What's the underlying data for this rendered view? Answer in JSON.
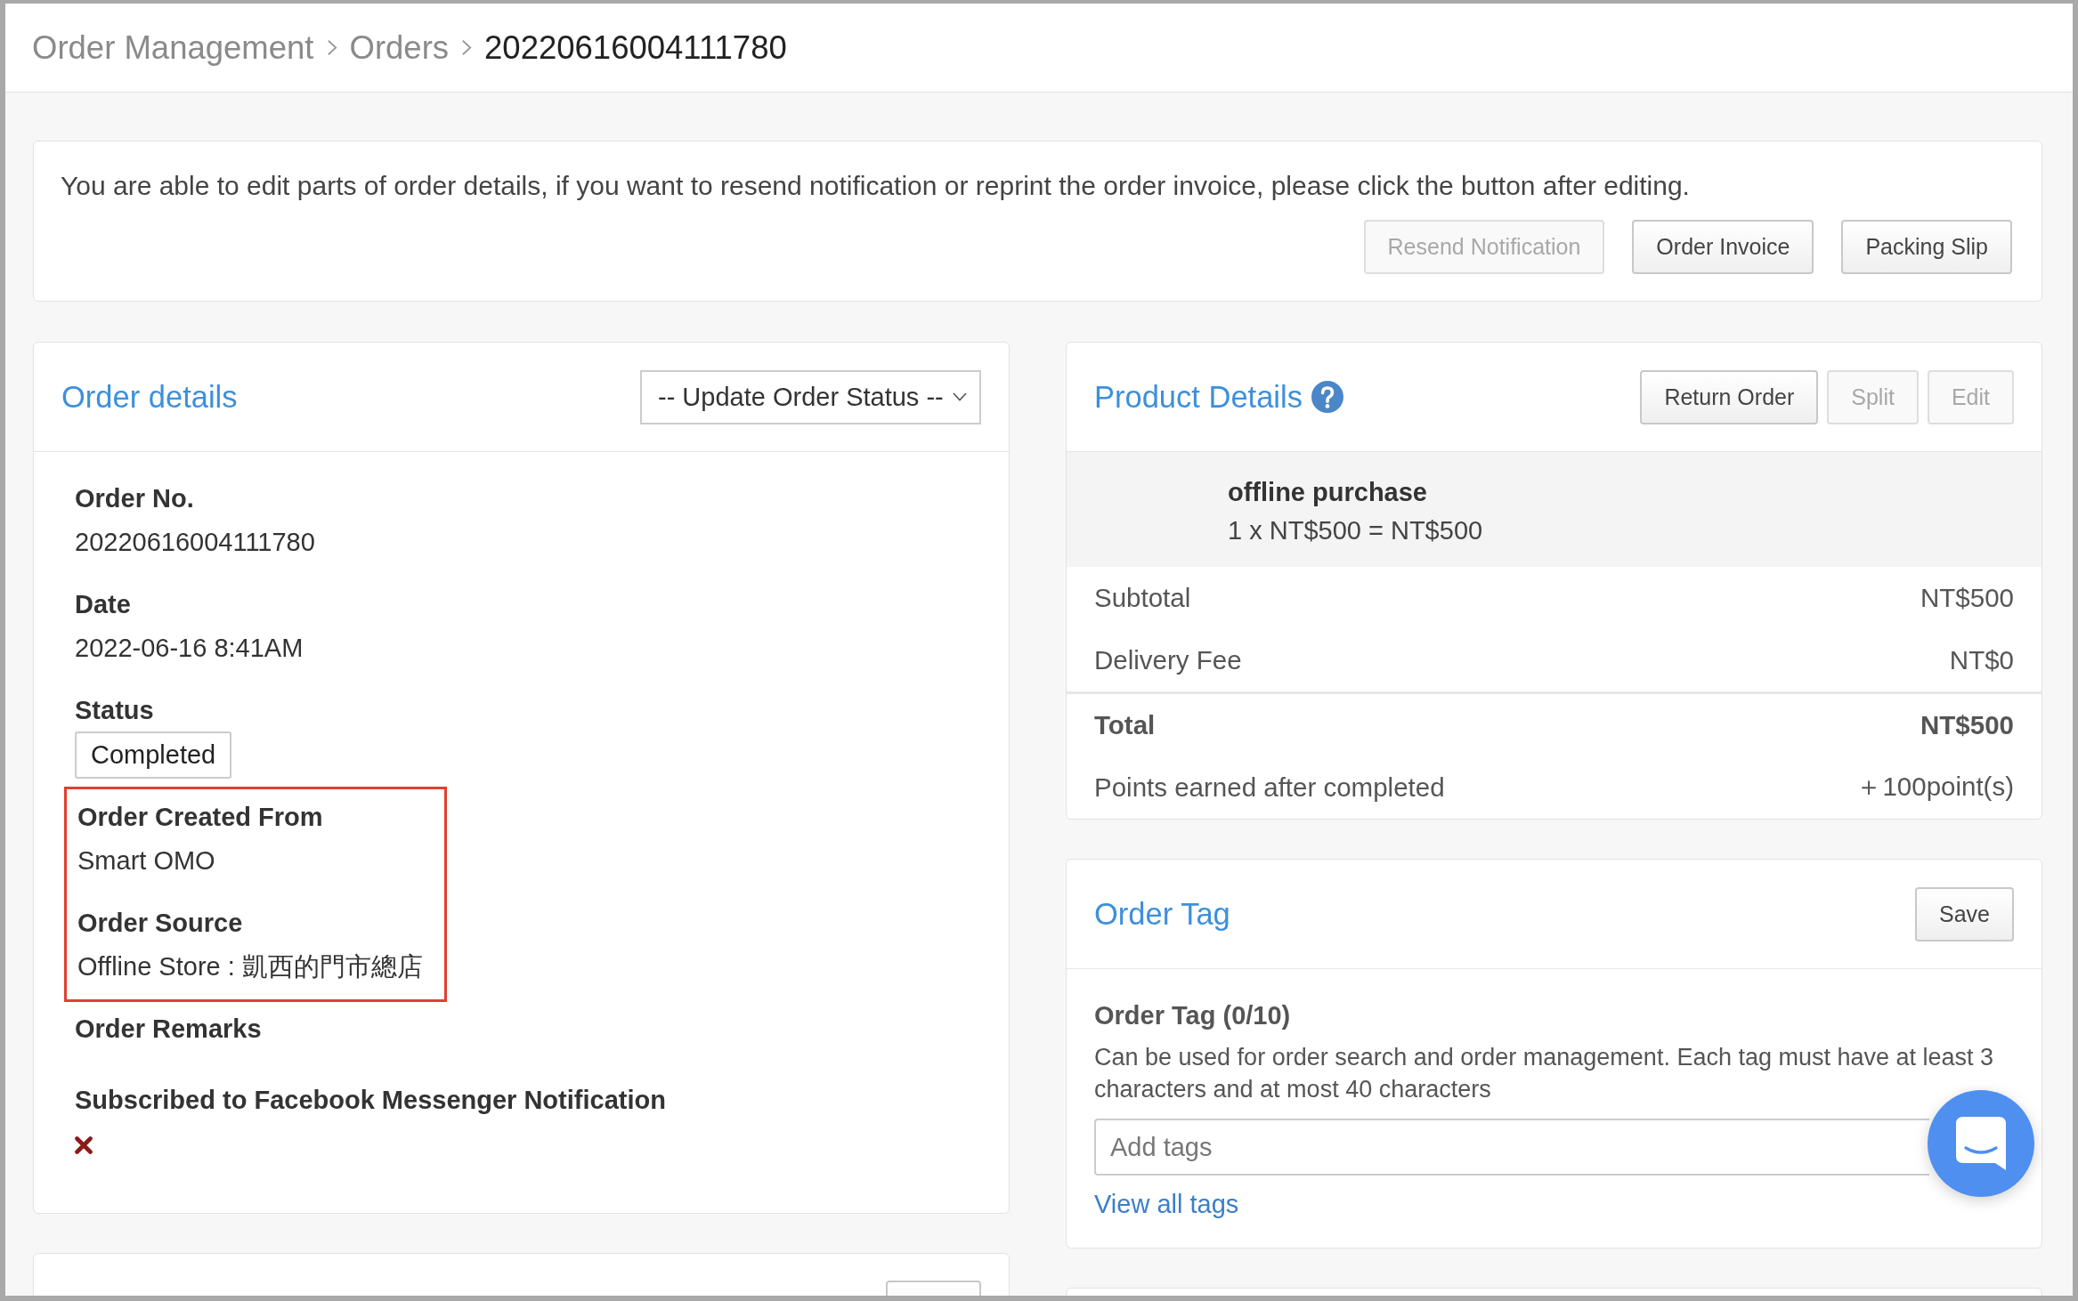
{
  "breadcrumb": [
    {
      "label": "Order Management",
      "current": false
    },
    {
      "label": "Orders",
      "current": false
    },
    {
      "label": "20220616004111780",
      "current": true
    }
  ],
  "notice": {
    "text": "You are able to edit parts of order details, if you want to resend notification or reprint the order invoice, please click the button after editing.",
    "buttons": [
      {
        "label": "Resend Notification",
        "disabled": true
      },
      {
        "label": "Order Invoice",
        "disabled": false
      },
      {
        "label": "Packing Slip",
        "disabled": false
      }
    ]
  },
  "order_details": {
    "title": "Order details",
    "status_select": {
      "value": "-- Update Order Status --"
    },
    "sections": [
      {
        "highlighted": false,
        "fields": [
          {
            "kind": "text",
            "label": "Order No.",
            "value": "20220616004111780"
          },
          {
            "kind": "text",
            "label": "Date",
            "value": "2022-06-16 8:41AM"
          },
          {
            "kind": "badge",
            "label": "Status",
            "value": "Completed"
          }
        ]
      },
      {
        "highlighted": true,
        "fields": [
          {
            "kind": "text",
            "label": "Order Created From",
            "value": "Smart OMO"
          },
          {
            "kind": "text",
            "label": "Order Source",
            "value": "Offline Store : 凱西的門市總店"
          }
        ]
      },
      {
        "highlighted": false,
        "fields": [
          {
            "kind": "text",
            "label": "Order Remarks"
          },
          {
            "kind": "flag",
            "label": "Subscribed to Facebook Messenger Notification",
            "checked": false
          }
        ]
      }
    ]
  },
  "product_details": {
    "title": "Product Details",
    "buttons": [
      {
        "label": "Return Order",
        "disabled": false
      },
      {
        "label": "Split",
        "disabled": true
      },
      {
        "label": "Edit",
        "disabled": true
      }
    ],
    "items": [
      {
        "name": "offline purchase",
        "line": "1 x NT$500 = NT$500"
      }
    ],
    "summary": [
      {
        "kind": "row",
        "label": "Subtotal",
        "value": "NT$500"
      },
      {
        "kind": "row",
        "label": "Delivery Fee",
        "value": "NT$0"
      },
      {
        "kind": "total",
        "label": "Total",
        "value": "NT$500"
      },
      {
        "kind": "row",
        "label": "Points earned after completed",
        "value": "＋100point(s)"
      }
    ]
  },
  "order_tag": {
    "title": "Order Tag",
    "save_button": {
      "label": "Save"
    },
    "field_label": "Order Tag (0/10)",
    "description": "Can be used for order search and order management. Each tag must have at least 3 characters and at most 40 characters",
    "input": {
      "placeholder": "Add tags"
    },
    "link": "View all tags"
  }
}
